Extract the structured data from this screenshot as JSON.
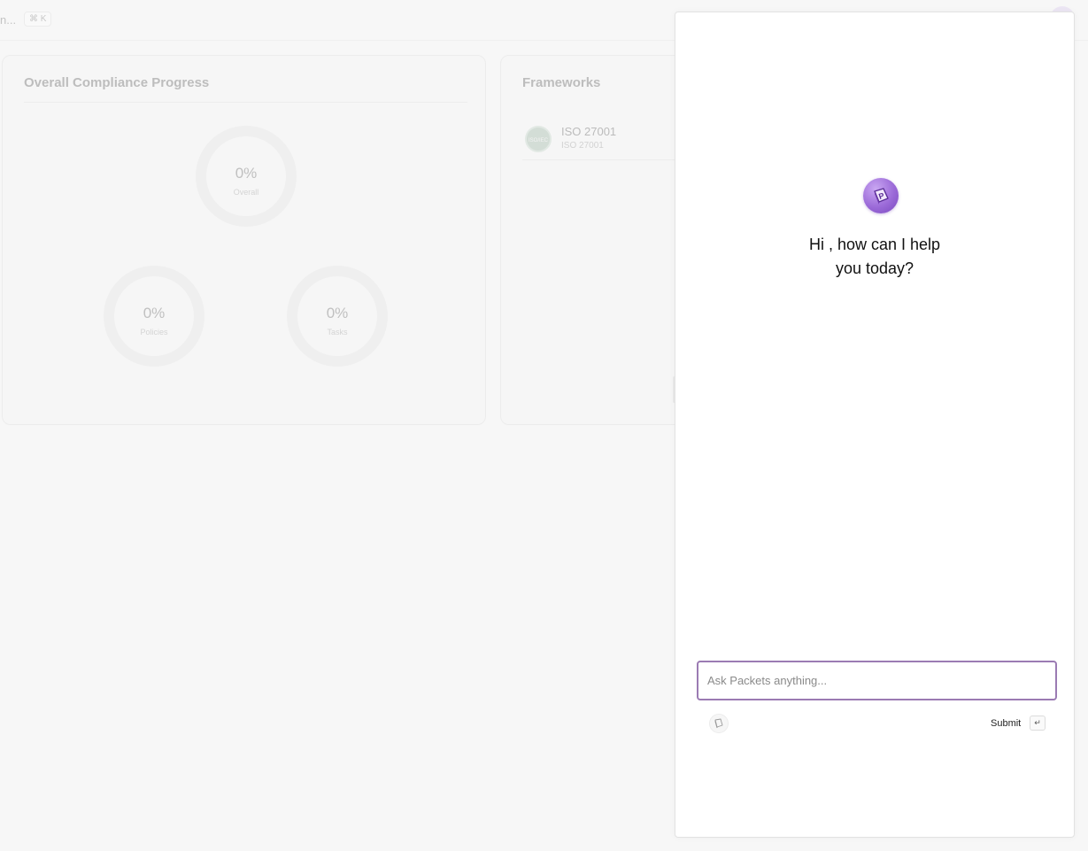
{
  "topbar": {
    "search_truncated": "n...",
    "shortcut": "⌘ K"
  },
  "compliance_card": {
    "title": "Overall Compliance Progress",
    "donuts": [
      {
        "value": "0%",
        "label": "Overall"
      },
      {
        "value": "0%",
        "label": "Policies"
      },
      {
        "value": "0%",
        "label": "Tasks"
      }
    ]
  },
  "frameworks_card": {
    "title": "Frameworks",
    "items": [
      {
        "name": "ISO 27001",
        "subtitle": "ISO 27001",
        "badge": "ISO/IEC"
      }
    ]
  },
  "chat": {
    "greeting_line1": "Hi , how can I help",
    "greeting_line2": "you today?",
    "input_placeholder": "Ask Packets anything...",
    "input_value": "",
    "submit_label": "Submit",
    "enter_key": "↵",
    "accent_color": "#9b7bb3",
    "logo_color": "#9b6ad8"
  }
}
